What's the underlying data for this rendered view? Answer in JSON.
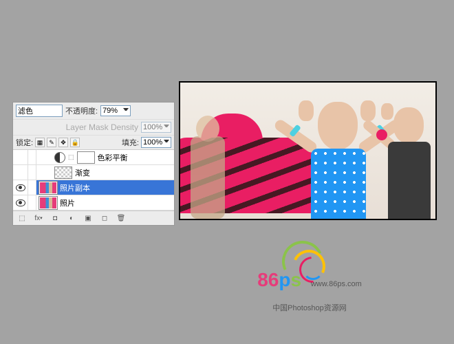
{
  "panel": {
    "blend_mode": "滤色",
    "opacity_label": "不透明度:",
    "opacity_value": "79%",
    "mask_density_label": "Layer Mask Density",
    "mask_density_value": "100%",
    "lock_label": "锁定:",
    "fill_label": "填充:",
    "fill_value": "100%"
  },
  "layers": [
    {
      "name": "色彩平衡",
      "type": "adjustment",
      "visible": false,
      "selected": false
    },
    {
      "name": "渐变",
      "type": "gradient",
      "visible": false,
      "selected": false
    },
    {
      "name": "照片副本",
      "type": "photo",
      "visible": true,
      "selected": true
    },
    {
      "name": "照片",
      "type": "photo",
      "visible": true,
      "selected": false
    }
  ],
  "logo": {
    "brand": "86ps",
    "url": "www.86ps.com",
    "tagline": "中国Photoshop资源网"
  }
}
